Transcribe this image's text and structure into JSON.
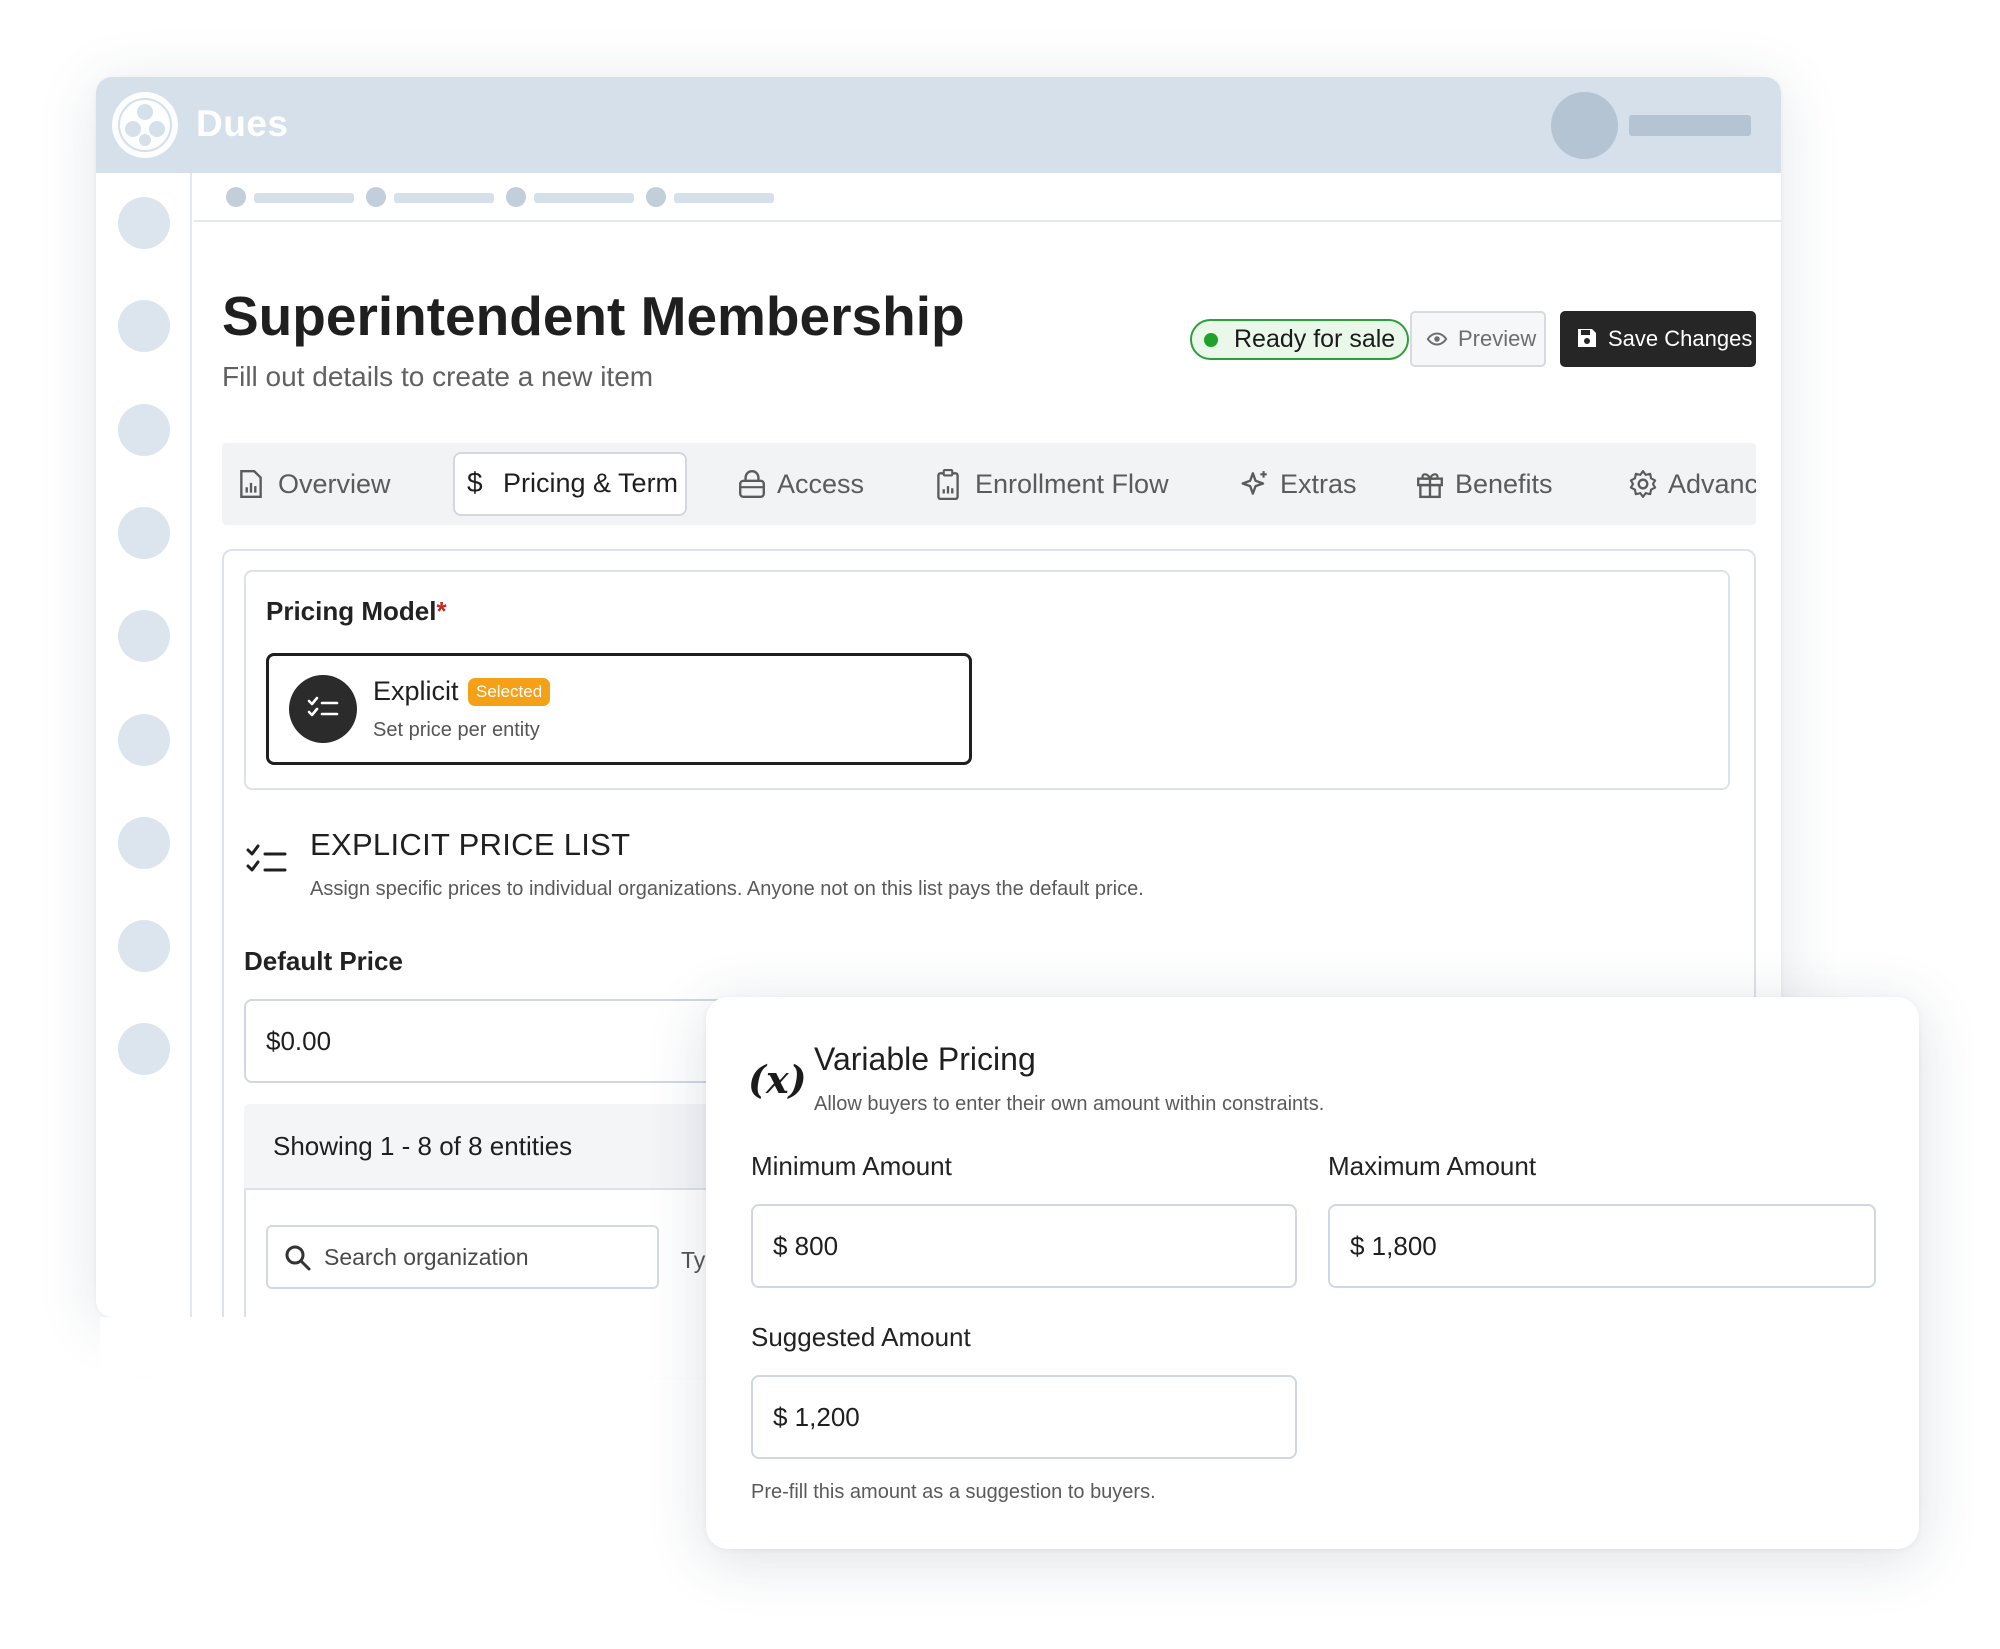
{
  "app": {
    "brand": "Dues"
  },
  "page": {
    "title": "Superintendent Membership",
    "subtitle": "Fill out details to create a new item"
  },
  "header_actions": {
    "status": "Ready for sale",
    "preview_label": "Preview",
    "save_label": "Save Changes",
    "status_color": "#1fa22b"
  },
  "tabs": [
    {
      "label": "Overview",
      "icon": "document-chart-icon"
    },
    {
      "label": "Pricing & Term",
      "icon": "dollar-icon",
      "active": true
    },
    {
      "label": "Access",
      "icon": "lock-icon"
    },
    {
      "label": "Enrollment Flow",
      "icon": "clipboard-icon"
    },
    {
      "label": "Extras",
      "icon": "sparkle-icon"
    },
    {
      "label": "Benefits",
      "icon": "gift-icon"
    },
    {
      "label": "Advanc",
      "icon": "gear-icon"
    }
  ],
  "pricing_model": {
    "label": "Pricing Model",
    "required_mark": "*",
    "option": {
      "title": "Explicit",
      "badge": "Selected",
      "description": "Set price per entity",
      "icon": "checklist-icon"
    }
  },
  "explicit_price_list": {
    "title": "EXPLICIT PRICE LIST",
    "description": "Assign specific prices to individual organizations. Anyone not on this list pays the default price."
  },
  "default_price": {
    "label": "Default Price",
    "value": "$0.00"
  },
  "entity_list": {
    "count_text": "Showing 1 - 8 of 8 entities",
    "search_placeholder": "Search organization",
    "type_label_partial": "Ty"
  },
  "variable_pricing": {
    "icon_text": "(x)",
    "title": "Variable Pricing",
    "description": "Allow buyers to enter their own amount within constraints.",
    "min_label": "Minimum Amount",
    "min_value": "$ 800",
    "max_label": "Maximum Amount",
    "max_value": "$ 1,800",
    "suggested_label": "Suggested Amount",
    "suggested_value": "$ 1,200",
    "help": "Pre-fill this amount as a suggestion to buyers."
  },
  "colors": {
    "topbar": "#d5e0eb",
    "accent_badge": "#f4a117",
    "save_button": "#262626"
  }
}
